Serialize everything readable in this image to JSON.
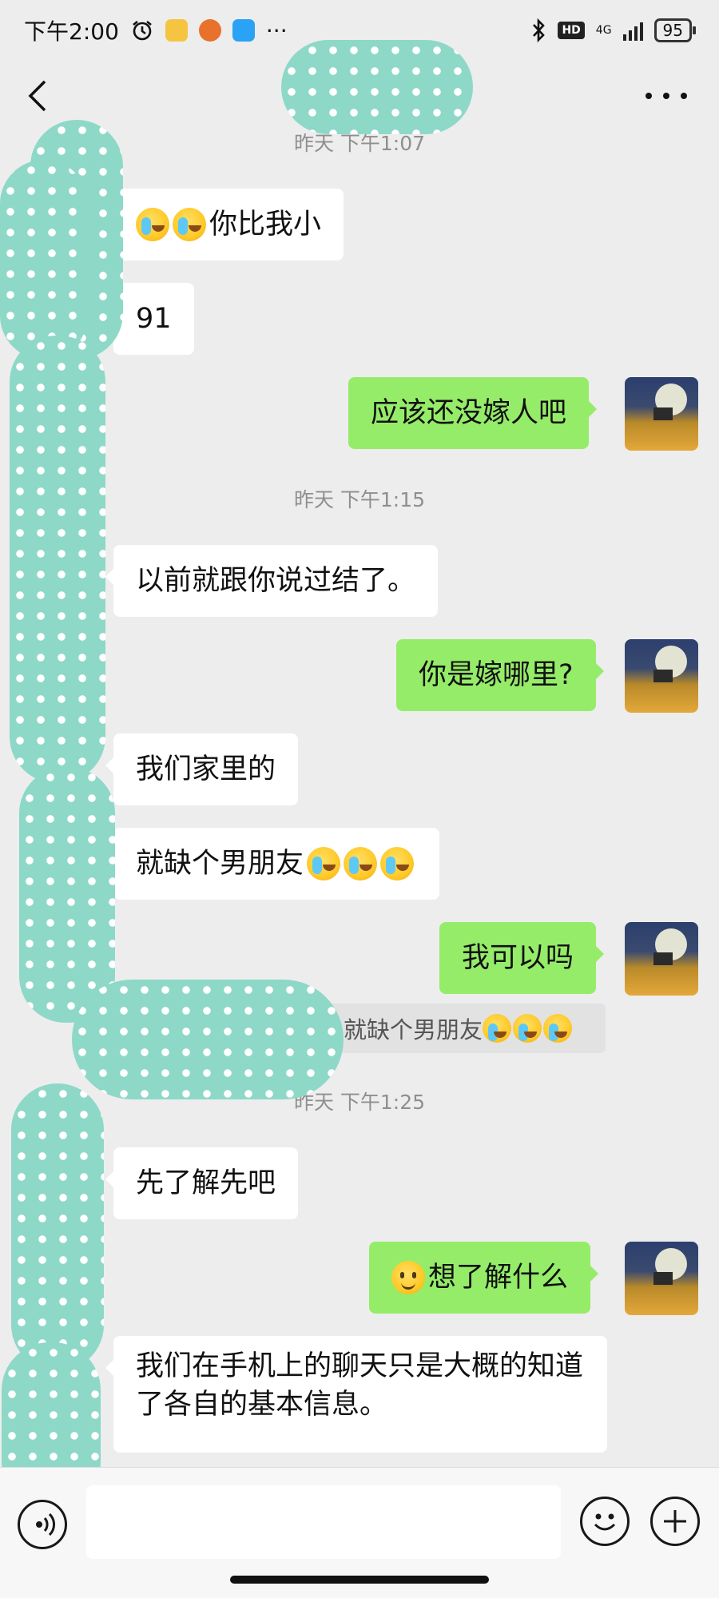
{
  "status_bar": {
    "time": "下午2:00",
    "more": "···",
    "network": "4G",
    "hd": "HD",
    "battery": "95"
  },
  "messages": [
    {
      "side": "in",
      "text": "你比我小",
      "prefix_emoji": [
        "cry",
        "cry"
      ]
    },
    {
      "side": "in",
      "text": "91"
    },
    {
      "side": "out",
      "text": "应该还没嫁人吧"
    },
    {
      "side": "in",
      "text": "以前就跟你说过结了。"
    },
    {
      "side": "out",
      "text": "你是嫁哪里?"
    },
    {
      "side": "in",
      "text": "我们家里的"
    },
    {
      "side": "in",
      "text": "就缺个男朋友",
      "suffix_emoji": [
        "cry",
        "cry",
        "cry"
      ]
    },
    {
      "side": "out",
      "text": "我可以吗"
    },
    {
      "side": "in",
      "text": "先了解先吧"
    },
    {
      "side": "out",
      "text": "想了解什么",
      "prefix_emoji": [
        "smile"
      ]
    },
    {
      "side": "in",
      "text": "我们在手机上的聊天只是大概的知道了各自的基本信息。"
    }
  ],
  "timestamps": [
    "昨天 下午1:07",
    "昨天 下午1:15",
    "昨天 下午1:25"
  ],
  "quote": {
    "text": "就缺个男朋友"
  },
  "colors": {
    "background": "#ededed",
    "incoming": "#ffffff",
    "outgoing": "#95ec69",
    "privacy_blob": "#8ed8c8"
  }
}
